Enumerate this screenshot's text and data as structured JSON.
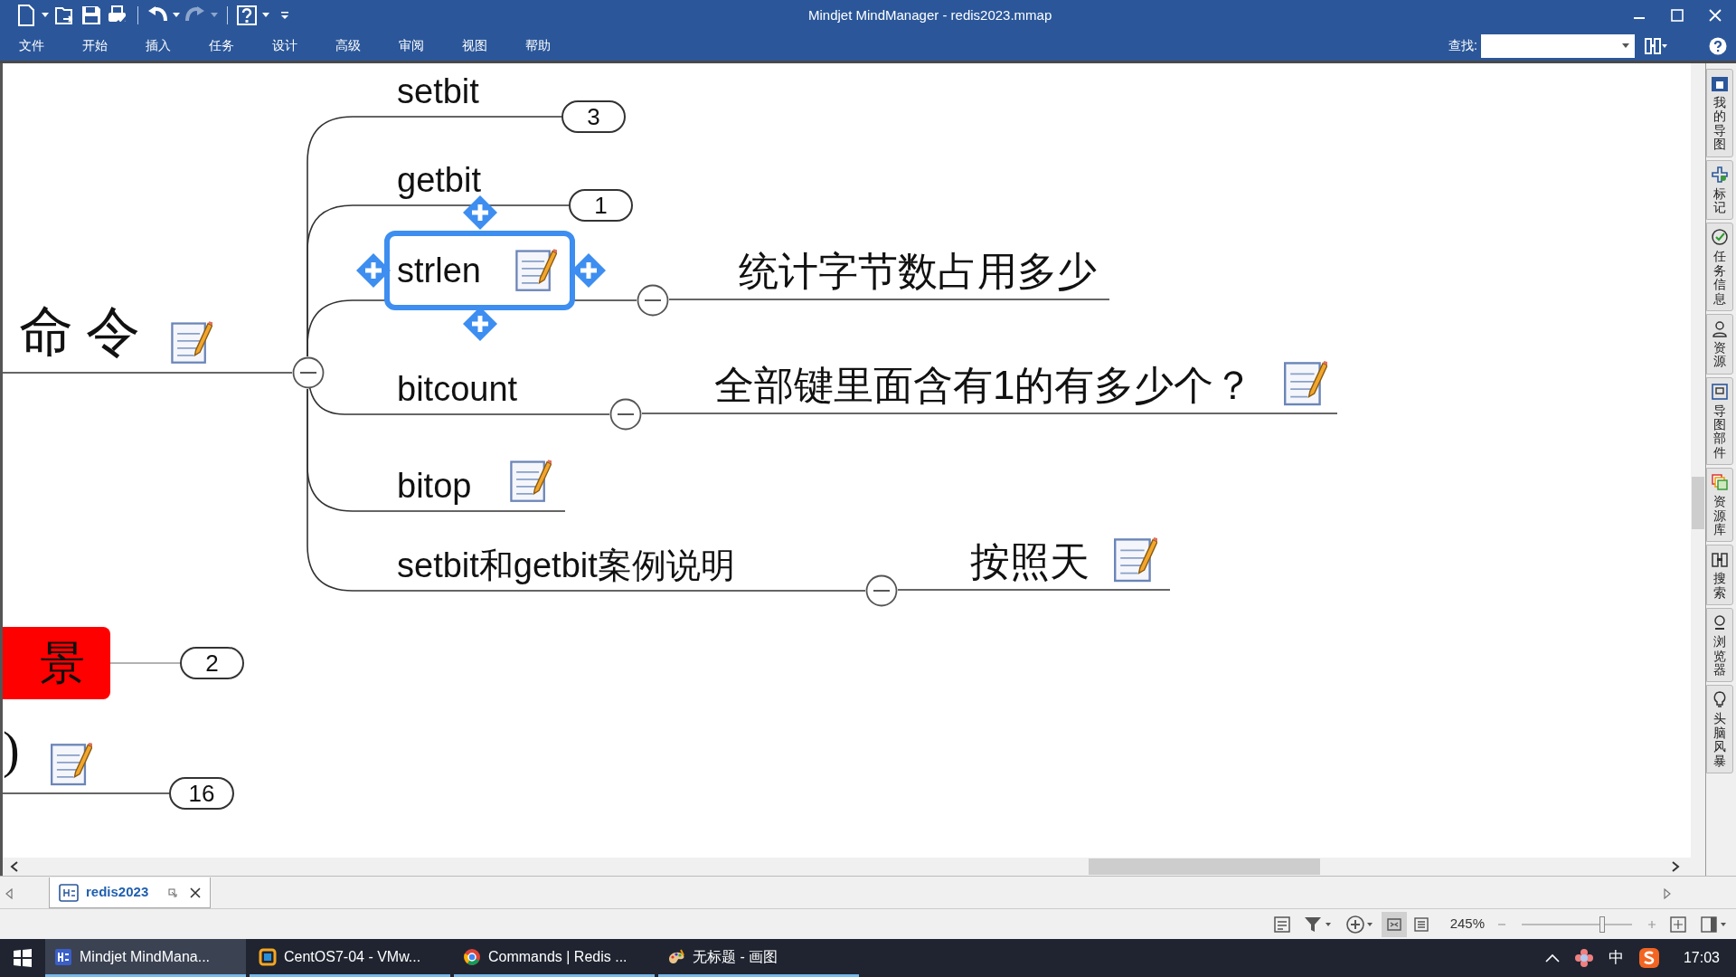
{
  "window": {
    "title": "Mindjet MindManager - redis2023.mmap"
  },
  "menu": [
    "文件",
    "开始",
    "插入",
    "任务",
    "设计",
    "高级",
    "审阅",
    "视图",
    "帮助"
  ],
  "search": {
    "label": "查找:"
  },
  "side_panel": {
    "tabs": [
      {
        "label": "我的导图",
        "kind": "maps"
      },
      {
        "label": "标记",
        "kind": "markers"
      },
      {
        "label": "任务信息",
        "kind": "task"
      },
      {
        "label": "资源",
        "kind": "resources"
      },
      {
        "label": "导图部件",
        "kind": "parts"
      },
      {
        "label": "资源库",
        "kind": "library"
      },
      {
        "label": "搜索",
        "kind": "search"
      },
      {
        "label": "浏览器",
        "kind": "browser"
      },
      {
        "label": "头脑风暴",
        "kind": "brainstorm"
      }
    ]
  },
  "map": {
    "topic": {
      "text": "命令",
      "has_note": true,
      "expanded": true,
      "children": [
        {
          "text": "setbit",
          "selected": false,
          "has_note": false,
          "expanded": false,
          "count": "3"
        },
        {
          "text": "getbit",
          "selected": false,
          "has_note": false,
          "expanded": false,
          "count": "1"
        },
        {
          "text": "strlen",
          "selected": true,
          "has_note": true,
          "expanded": true,
          "children": [
            {
              "text": "统计字节数占用多少",
              "has_note": false
            }
          ]
        },
        {
          "text": "bitcount",
          "selected": false,
          "has_note": false,
          "expanded": true,
          "children": [
            {
              "text": "全部键里面含有1的有多少个？",
              "has_note": true
            }
          ]
        },
        {
          "text": "bitop",
          "selected": false,
          "has_note": true,
          "expanded": true
        },
        {
          "text": "setbit和getbit案例说明",
          "selected": false,
          "has_note": false,
          "expanded": true,
          "children": [
            {
              "text": "按照天",
              "has_note": true
            }
          ]
        }
      ]
    },
    "other_topics": [
      {
        "kind": "highlighted",
        "text": "景",
        "color": "#ff0000",
        "has_note": false,
        "count": "2"
      },
      {
        "kind": "plain",
        "text": ")",
        "has_note": true,
        "count": "16"
      }
    ]
  },
  "document_tabs": [
    {
      "label": "redis2023",
      "selected": true
    }
  ],
  "status_bar": {
    "view_modes": [
      {
        "kind": "map",
        "selected": true
      },
      {
        "kind": "outline",
        "selected": false
      }
    ],
    "zoom": "245%",
    "zoom_slider": {
      "level": 0.73
    }
  },
  "taskbar": {
    "items": [
      {
        "label": "Mindjet MindMana...",
        "kind": "mindjet",
        "selected": true
      },
      {
        "label": "CentOS7-04 - VMw...",
        "kind": "vmware",
        "selected": false
      },
      {
        "label": "Commands | Redis ...",
        "kind": "chrome",
        "selected": false
      },
      {
        "label": "无标题 - 画图",
        "kind": "paint",
        "selected": false
      }
    ],
    "ime": "中",
    "time": "17:03"
  }
}
